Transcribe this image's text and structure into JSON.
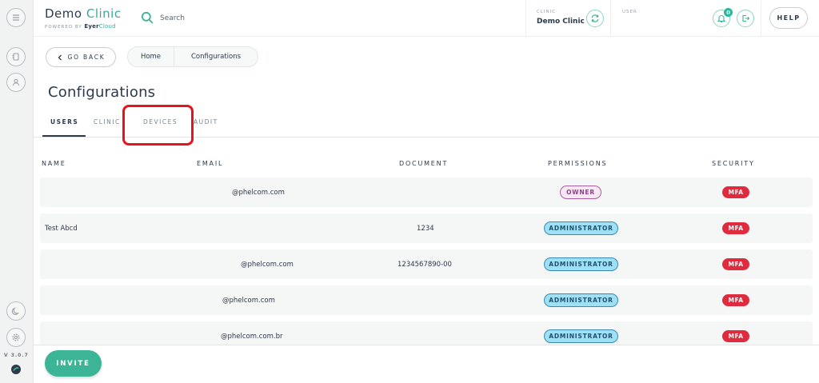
{
  "header": {
    "brand_name_1": "Demo",
    "brand_name_2": "Clinic",
    "powered_by": "POWERED BY",
    "powered_eyer": "Eyer",
    "powered_cloud": "Cloud",
    "search_placeholder": "Search",
    "clinic_caption": "CLINIC",
    "clinic_name": "Demo Clinic",
    "user_caption": "USER",
    "notification_count": "0",
    "help_label": "HELP"
  },
  "nav": {
    "back_label": "GO BACK",
    "breadcrumb": [
      "Home",
      "Configurations"
    ]
  },
  "page": {
    "title": "Configurations",
    "tabs": [
      "USERS",
      "CLINIC",
      "DEVICES",
      "AUDIT"
    ],
    "active_tab": "USERS"
  },
  "table": {
    "columns": [
      "NAME",
      "EMAIL",
      "DOCUMENT",
      "PERMISSIONS",
      "SECURITY"
    ],
    "rows": [
      {
        "name": "",
        "email": "@phelcom.com",
        "document": "",
        "permission": "OWNER",
        "security": "MFA"
      },
      {
        "name": "Test Abcd",
        "email": "",
        "document": "1234",
        "permission": "ADMINISTRATOR",
        "security": "MFA"
      },
      {
        "name": "",
        "email": "@phelcom.com",
        "document": "1234567890-00",
        "permission": "ADMINISTRATOR",
        "security": "MFA"
      },
      {
        "name": "",
        "email": "@phelcom.com",
        "document": "",
        "permission": "ADMINISTRATOR",
        "security": "MFA"
      },
      {
        "name": "",
        "email": "@phelcom.com.br",
        "document": "",
        "permission": "ADMINISTRATOR",
        "security": "MFA"
      }
    ]
  },
  "sidebar": {
    "version": "V 3.0.7"
  },
  "footer": {
    "invite_label": "INVITE"
  },
  "colors": {
    "accent": "#3bb595",
    "highlight": "#e8141c",
    "mfa": "#e02b3f",
    "admin": "#9ee1f6"
  }
}
